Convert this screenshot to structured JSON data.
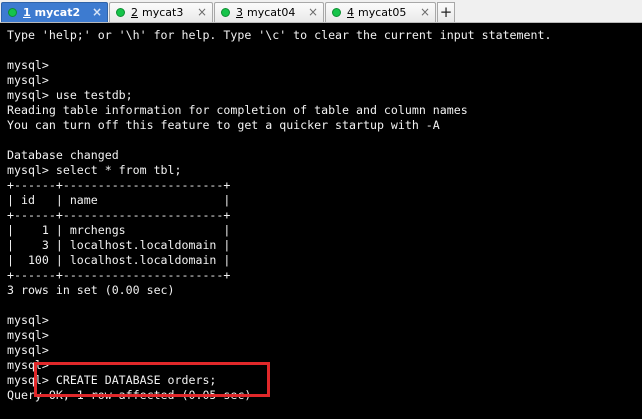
{
  "tabs": [
    {
      "number": "1",
      "name": "mycat2",
      "active": true,
      "status_color": "#16c44a"
    },
    {
      "number": "2",
      "name": "mycat3",
      "active": false,
      "status_color": "#16c44a"
    },
    {
      "number": "3",
      "name": "mycat04",
      "active": false,
      "status_color": "#16c44a"
    },
    {
      "number": "4",
      "name": "mycat05",
      "active": false,
      "status_color": "#16c44a"
    }
  ],
  "tab_close_glyph": "×",
  "tab_add_glyph": "+",
  "terminal": {
    "lines": [
      "Type 'help;' or '\\h' for help. Type '\\c' to clear the current input statement.",
      "",
      "mysql>",
      "mysql>",
      "mysql> use testdb;",
      "Reading table information for completion of table and column names",
      "You can turn off this feature to get a quicker startup with -A",
      "",
      "Database changed",
      "mysql> select * from tbl;",
      "+------+-----------------------+",
      "| id   | name                  |",
      "+------+-----------------------+",
      "|    1 | mrchengs              |",
      "|    3 | localhost.localdomain |",
      "|  100 | localhost.localdomain |",
      "+------+-----------------------+",
      "3 rows in set (0.00 sec)",
      "",
      "mysql>",
      "mysql>",
      "mysql>",
      "mysql>",
      "mysql> CREATE DATABASE orders;",
      "Query OK, 1 row affected (0.05 sec)"
    ]
  },
  "colors": {
    "terminal_bg": "#000000",
    "terminal_fg": "#f2f2f2",
    "active_tab": "#3d7bd0",
    "highlight": "#e0282a"
  }
}
